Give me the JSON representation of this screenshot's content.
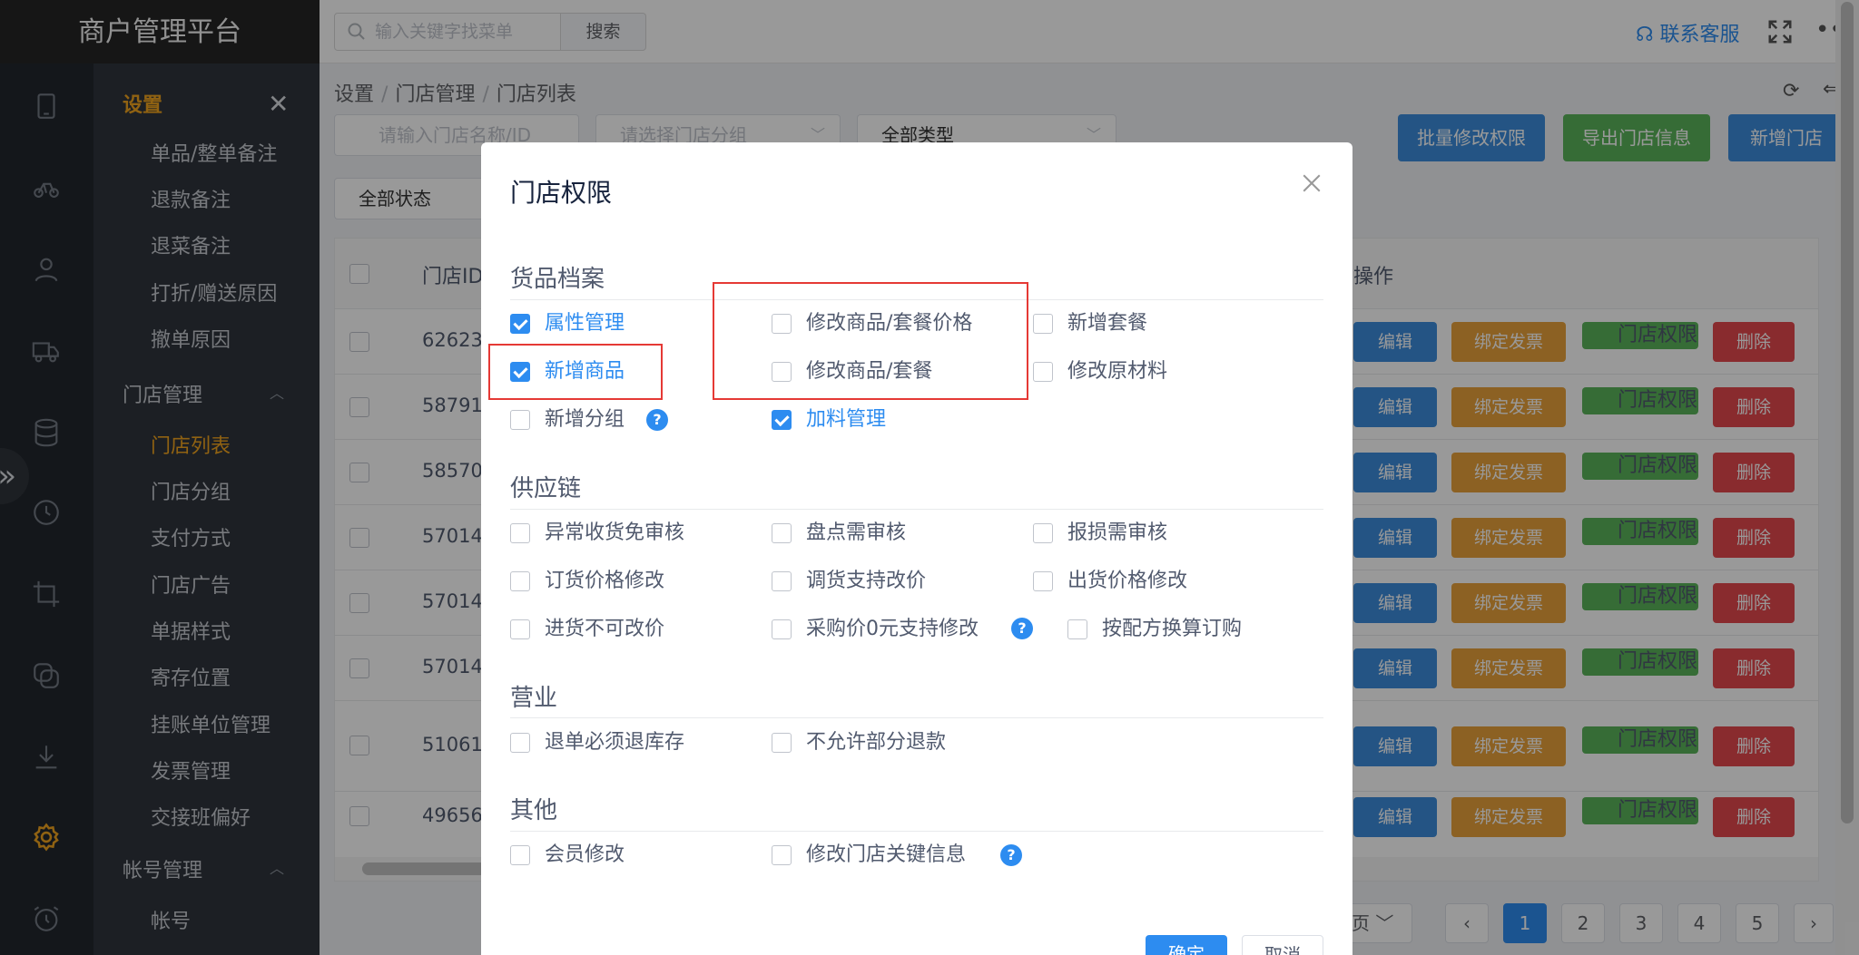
{
  "brand": "商户管理平台",
  "topbar": {
    "search_placeholder": "输入关键字找菜单",
    "search_button": "搜索",
    "service_label": "联系客服"
  },
  "submenu": {
    "settings_title": "设置",
    "settings_items": [
      "单品/整单备注",
      "退款备注",
      "退菜备注",
      "打折/赠送原因",
      "撤单原因"
    ],
    "store_title": "门店管理",
    "store_items": [
      "门店列表",
      "门店分组",
      "支付方式",
      "门店广告",
      "单据样式",
      "寄存位置",
      "挂账单位管理",
      "发票管理",
      "交接班偏好"
    ],
    "active_item": "门店列表",
    "account_title": "帐号管理",
    "account_items": [
      "帐号"
    ]
  },
  "breadcrumb": [
    "设置",
    "门店管理",
    "门店列表"
  ],
  "filters": {
    "store_name_placeholder": "请输入门店名称/ID",
    "group_placeholder": "请选择门店分组",
    "type_value": "全部类型",
    "status_value": "全部状态"
  },
  "actions": {
    "batch_perm": "批量修改权限",
    "export": "导出门店信息",
    "add_store": "新增门店"
  },
  "table": {
    "col_id": "门店ID",
    "col_op": "操作",
    "rows": [
      "62623",
      "58791",
      "58570",
      "57014",
      "57014",
      "57014",
      "51061",
      "49656"
    ],
    "op_edit": "编辑",
    "op_invoice": "绑定发票",
    "op_perm": "门店权限",
    "op_delete": "删除"
  },
  "pagination": {
    "per_page_suffix": "页",
    "pages": [
      "1",
      "2",
      "3",
      "4",
      "5"
    ],
    "current": "1"
  },
  "modal": {
    "title": "门店权限",
    "sections": [
      {
        "title": "货品档案",
        "items": [
          {
            "label": "属性管理",
            "checked": true
          },
          {
            "label": "修改商品/套餐价格",
            "checked": false
          },
          {
            "label": "新增套餐",
            "checked": false
          },
          {
            "label": "新增商品",
            "checked": true
          },
          {
            "label": "修改商品/套餐",
            "checked": false
          },
          {
            "label": "修改原材料",
            "checked": false
          },
          {
            "label": "新增分组",
            "checked": false,
            "help": true
          },
          {
            "label": "加料管理",
            "checked": true
          }
        ]
      },
      {
        "title": "供应链",
        "items": [
          {
            "label": "异常收货免审核",
            "checked": false
          },
          {
            "label": "盘点需审核",
            "checked": false
          },
          {
            "label": "报损需审核",
            "checked": false
          },
          {
            "label": "订货价格修改",
            "checked": false
          },
          {
            "label": "调货支持改价",
            "checked": false
          },
          {
            "label": "出货价格修改",
            "checked": false
          },
          {
            "label": "进货不可改价",
            "checked": false
          },
          {
            "label": "采购价0元支持修改",
            "checked": false,
            "help": true
          },
          {
            "label": "按配方换算订购",
            "checked": false
          }
        ]
      },
      {
        "title": "营业",
        "items": [
          {
            "label": "退单必须退库存",
            "checked": false
          },
          {
            "label": "不允许部分退款",
            "checked": false
          }
        ]
      },
      {
        "title": "其他",
        "items": [
          {
            "label": "会员修改",
            "checked": false
          },
          {
            "label": "修改门店关键信息",
            "checked": false,
            "help": true
          }
        ]
      }
    ],
    "ok_label": "确定",
    "cancel_label": "取消",
    "help_glyph": "?"
  },
  "colors": {
    "accent": "#2d8cf0",
    "sidebar_active": "#f0a41e",
    "highlight_box": "#e53935"
  }
}
